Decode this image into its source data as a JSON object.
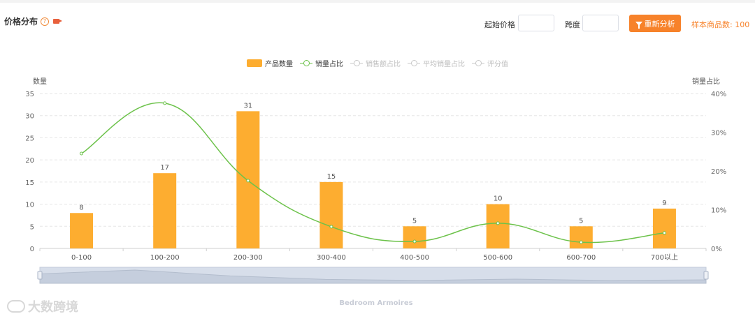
{
  "header": {
    "title": "价格分布",
    "help_glyph": "?",
    "start_price_label": "起始价格",
    "start_price_value": "",
    "span_label": "跨度",
    "span_value": "",
    "reanalyze_label": "重新分析",
    "sample_count": "样本商品数: 100"
  },
  "legend": [
    {
      "label": "产品数量",
      "kind": "bar",
      "color": "#fdad30",
      "active": true
    },
    {
      "label": "销量占比",
      "kind": "line",
      "color": "#6cc24a",
      "active": true
    },
    {
      "label": "销售额占比",
      "kind": "line",
      "color": "#c8c8c8",
      "active": false
    },
    {
      "label": "平均销量占比",
      "kind": "line",
      "color": "#c8c8c8",
      "active": false
    },
    {
      "label": "评分值",
      "kind": "line",
      "color": "#c8c8c8",
      "active": false
    }
  ],
  "chart_data": {
    "type": "bar",
    "categories": [
      "0-100",
      "100-200",
      "200-300",
      "300-400",
      "400-500",
      "500-600",
      "600-700",
      "700以上"
    ],
    "series": [
      {
        "name": "产品数量",
        "type": "bar",
        "axis": "left",
        "values": [
          8,
          17,
          31,
          15,
          5,
          10,
          5,
          9
        ],
        "color": "#fdad30"
      },
      {
        "name": "销量占比",
        "type": "line",
        "axis": "right",
        "values": [
          24.5,
          37.5,
          17.5,
          5.6,
          1.8,
          6.5,
          1.6,
          4.0
        ],
        "color": "#6cc24a"
      }
    ],
    "ylabel_left": "数量",
    "ylabel_right": "销量占比",
    "ylim_left": [
      0,
      35
    ],
    "yticks_left": [
      0,
      5,
      10,
      15,
      20,
      25,
      30,
      35
    ],
    "ylim_right": [
      0,
      40
    ],
    "yticks_right": [
      "0%",
      "10%",
      "20%",
      "30%",
      "40%"
    ],
    "grid": true,
    "legend_position": "top-center",
    "zoom_range": "full",
    "footer_label": "Bedroom Armoires"
  },
  "watermark": "大数跨境"
}
